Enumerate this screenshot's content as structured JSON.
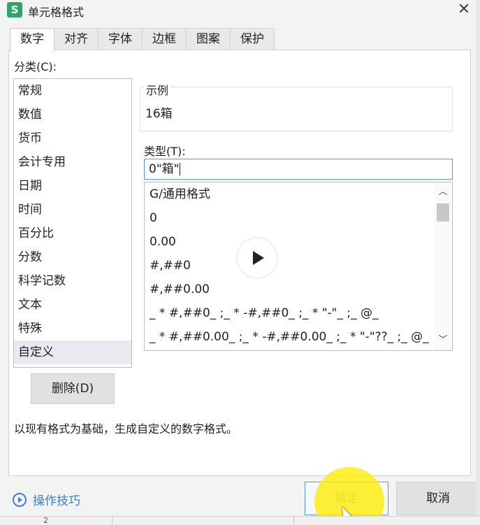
{
  "window": {
    "app_icon": "S",
    "title": "单元格格式",
    "close_icon": "close-icon"
  },
  "tabs": [
    {
      "label": "数字",
      "active": true
    },
    {
      "label": "对齐",
      "active": false
    },
    {
      "label": "字体",
      "active": false
    },
    {
      "label": "边框",
      "active": false
    },
    {
      "label": "图案",
      "active": false
    },
    {
      "label": "保护",
      "active": false
    }
  ],
  "category": {
    "label": "分类(C):",
    "items": [
      "常规",
      "数值",
      "货币",
      "会计专用",
      "日期",
      "时间",
      "百分比",
      "分数",
      "科学记数",
      "文本",
      "特殊",
      "自定义"
    ],
    "selected": "自定义"
  },
  "sample": {
    "legend": "示例",
    "value": "16箱"
  },
  "type": {
    "label": "类型(T):",
    "value": "0\"箱\""
  },
  "format_list": [
    "G/通用格式",
    "0",
    "0.00",
    "#,##0",
    "#,##0.00",
    "_ * #,##0_ ;_ * -#,##0_ ;_ * \"-\"_ ;_ @_",
    "_ * #,##0.00_ ;_ * -#,##0.00_ ;_ * \"-\"??_ ;_ @_"
  ],
  "buttons": {
    "delete": "删除(D)",
    "ok": "确定",
    "cancel": "取消"
  },
  "description": "以现有格式为基础，生成自定义的数字格式。",
  "tips": {
    "label": "操作技巧"
  },
  "sheet_row_number": "2",
  "colors": {
    "accent": "#3f7fd2",
    "selection": "#e8eaf0",
    "click_highlight": "#ffec00",
    "app_icon_bg": "#2fa56d"
  }
}
